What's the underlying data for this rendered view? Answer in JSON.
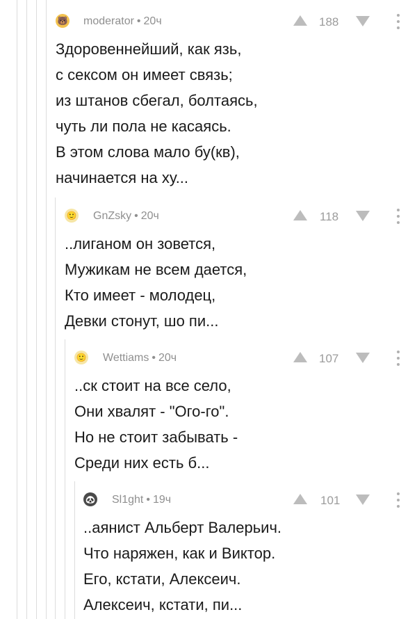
{
  "comments": [
    {
      "username": "moderator",
      "time": "20ч",
      "rating": "188",
      "avatar_icon": "bear-face-icon",
      "lines": [
        "Здоровеннейший, как язь,",
        "с сексом он имеет связь;",
        "из штанов сбегал, болтаясь,",
        "чуть ли пола не касаясь.",
        "В этом слова мало бу(кв),",
        "начинается на ху..."
      ]
    },
    {
      "username": "GnZsky",
      "time": "20ч",
      "rating": "118",
      "avatar_icon": "default-avatar-icon",
      "lines": [
        "..лиганом он зовется,",
        "Мужикам не всем дается,",
        "Кто имеет - молодец,",
        "Девки стонут, шо пи..."
      ]
    },
    {
      "username": "Wettiams",
      "time": "20ч",
      "rating": "107",
      "avatar_icon": "default-avatar-icon",
      "lines": [
        "..ск стоит на все село,",
        "Они хвалят - \"Ого-го\".",
        "Но не стоит забывать -",
        "Среди них есть б..."
      ]
    },
    {
      "username": "Sl1ght",
      "time": "19ч",
      "rating": "101",
      "avatar_icon": "panda-icon",
      "lines": [
        "..аянист Альберт Валерьич.",
        "Что наряжен, как и Виктор.",
        "Его, кстати, Алексеич.",
        "Алексеич, кстати, пи..."
      ]
    }
  ],
  "separator": "•"
}
